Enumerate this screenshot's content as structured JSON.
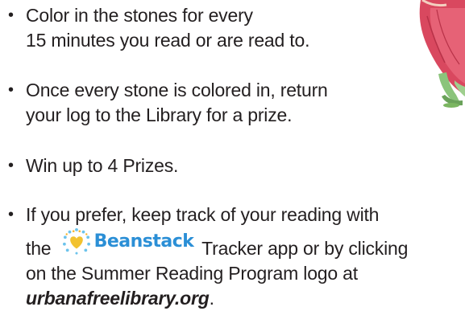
{
  "bullets": [
    {
      "marker": "•",
      "line1": "Color in the stones for every",
      "line2": "15 minutes you read or are read to."
    },
    {
      "marker": "•",
      "line1": "Once every stone is colored in, return",
      "line2": "your log to the Library for a prize."
    },
    {
      "marker": "•",
      "line1": "Win up to 4 Prizes."
    },
    {
      "marker": "•",
      "line1": "If you prefer, keep track of your reading with",
      "line2_before": "the",
      "beanstack_name": "Beanstack",
      "line2_after": "Tracker app or by clicking",
      "line3": "on the Summer Reading Program logo at",
      "link": "urbanafreelibrary.org",
      "link_suffix": "."
    }
  ],
  "colors": {
    "text": "#231f20",
    "beanstack_blue": "#2b8fd6",
    "beanstack_heart": "#f2c230",
    "illustration_pink": "#d9485f",
    "illustration_green": "#7bb661"
  },
  "icons": {
    "beanstack_logo": "beanstack-sunburst-heart-icon",
    "illustration": "character-illustration"
  }
}
